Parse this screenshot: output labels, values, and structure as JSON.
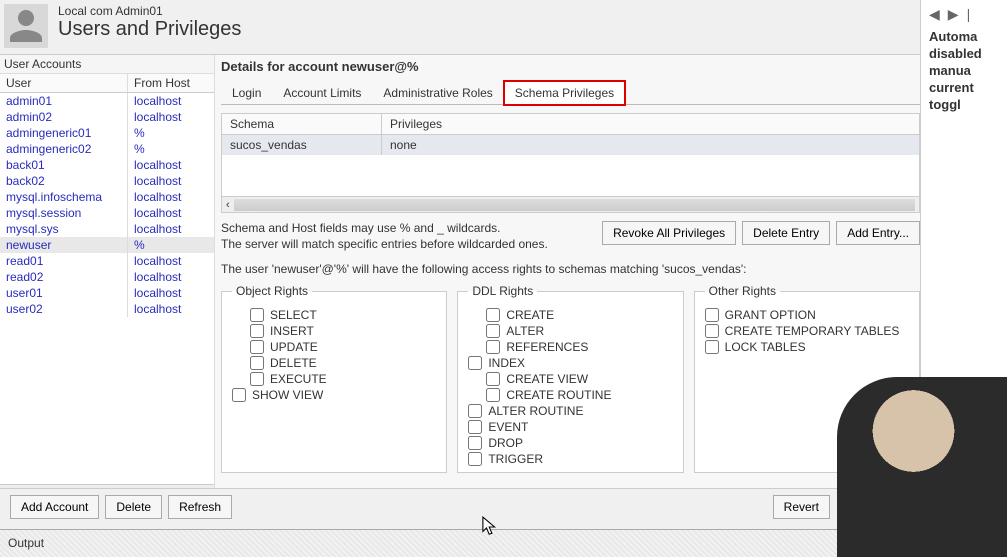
{
  "header": {
    "connection": "Local com Admin01",
    "title": "Users and Privileges"
  },
  "sidebar_help": [
    "Automa",
    "disabled",
    "manua",
    "current",
    "toggl"
  ],
  "user_accounts": {
    "title": "User Accounts",
    "col_user": "User",
    "col_host": "From Host",
    "rows": [
      {
        "user": "admin01",
        "host": "localhost",
        "sel": false
      },
      {
        "user": "admin02",
        "host": "localhost",
        "sel": false
      },
      {
        "user": "admingeneric01",
        "host": "%",
        "sel": false
      },
      {
        "user": "admingeneric02",
        "host": "%",
        "sel": false
      },
      {
        "user": "back01",
        "host": "localhost",
        "sel": false
      },
      {
        "user": "back02",
        "host": "localhost",
        "sel": false
      },
      {
        "user": "mysql.infoschema",
        "host": "localhost",
        "sel": false
      },
      {
        "user": "mysql.session",
        "host": "localhost",
        "sel": false
      },
      {
        "user": "mysql.sys",
        "host": "localhost",
        "sel": false
      },
      {
        "user": "newuser",
        "host": "%",
        "sel": true
      },
      {
        "user": "read01",
        "host": "localhost",
        "sel": false
      },
      {
        "user": "read02",
        "host": "localhost",
        "sel": false
      },
      {
        "user": "user01",
        "host": "localhost",
        "sel": false
      },
      {
        "user": "user02",
        "host": "localhost",
        "sel": false
      }
    ]
  },
  "details": {
    "title": "Details for account newuser@%",
    "tabs": [
      "Login",
      "Account Limits",
      "Administrative Roles",
      "Schema Privileges"
    ],
    "active_tab": "Schema Privileges"
  },
  "schema": {
    "col_schema": "Schema",
    "col_priv": "Privileges",
    "row": {
      "schema": "sucos_vendas",
      "priv": "none"
    }
  },
  "note": {
    "line1": "Schema and Host fields may use % and _ wildcards.",
    "line2": "The server will match specific entries before wildcarded ones."
  },
  "buttons": {
    "revoke": "Revoke All Privileges",
    "delete_entry": "Delete Entry",
    "add_entry": "Add Entry...",
    "add_account": "Add Account",
    "delete": "Delete",
    "refresh": "Refresh",
    "revert": "Revert"
  },
  "access_text": "The user 'newuser'@'%' will have the following access rights to schemas matching 'sucos_vendas':",
  "rights": {
    "object": {
      "legend": "Object Rights",
      "items": [
        "SELECT",
        "INSERT",
        "UPDATE",
        "DELETE",
        "EXECUTE",
        "SHOW VIEW"
      ]
    },
    "ddl": {
      "legend": "DDL Rights",
      "items": [
        "CREATE",
        "ALTER",
        "REFERENCES",
        "INDEX",
        "CREATE VIEW",
        "CREATE ROUTINE",
        "ALTER ROUTINE",
        "EVENT",
        "DROP",
        "TRIGGER"
      ]
    },
    "other": {
      "legend": "Other Rights",
      "items": [
        "GRANT OPTION",
        "CREATE TEMPORARY TABLES",
        "LOCK TABLES"
      ]
    }
  },
  "output_label": "Output"
}
